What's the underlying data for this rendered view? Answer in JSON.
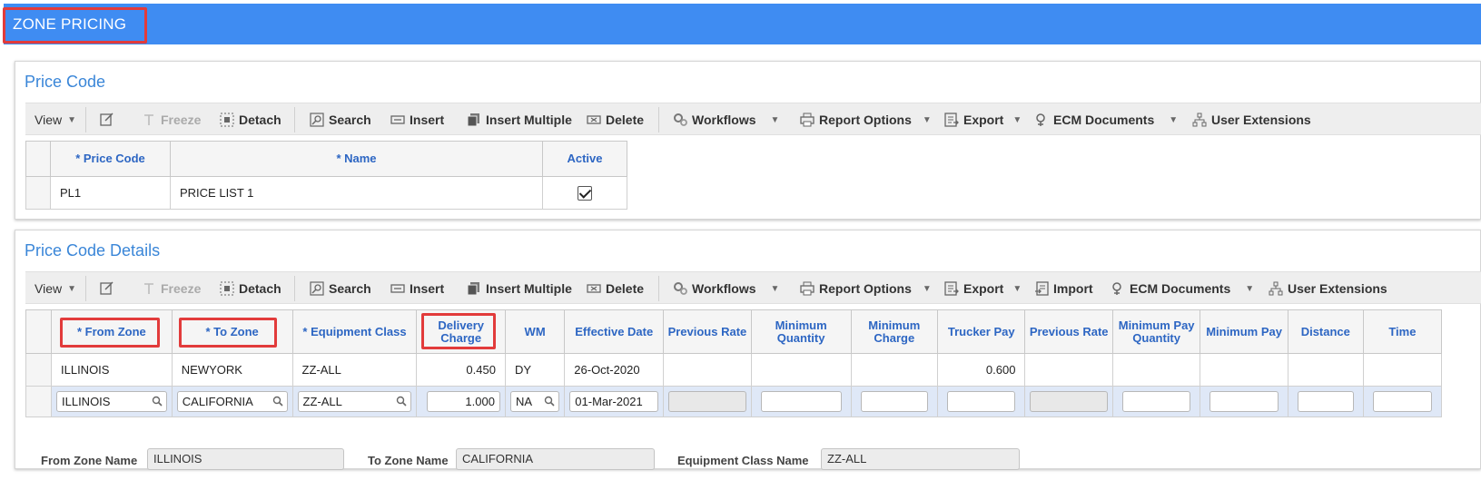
{
  "app": {
    "title": "ZONE PRICING"
  },
  "price_code_panel": {
    "title": "Price Code",
    "toolbar": {
      "view": "View",
      "freeze": "Freeze",
      "detach": "Detach",
      "search": "Search",
      "insert": "Insert",
      "insert_multiple": "Insert Multiple",
      "delete": "Delete",
      "workflows": "Workflows",
      "report_options": "Report Options",
      "export": "Export",
      "ecm_documents": "ECM Documents",
      "user_extensions": "User Extensions"
    },
    "columns": [
      "* Price Code",
      "* Name",
      "Active"
    ],
    "rows": [
      {
        "price_code": "PL1",
        "name": "PRICE LIST 1",
        "active": true
      }
    ]
  },
  "details_panel": {
    "title": "Price Code Details",
    "toolbar": {
      "view": "View",
      "freeze": "Freeze",
      "detach": "Detach",
      "search": "Search",
      "insert": "Insert",
      "insert_multiple": "Insert Multiple",
      "delete": "Delete",
      "workflows": "Workflows",
      "report_options": "Report Options",
      "export": "Export",
      "import": "Import",
      "ecm_documents": "ECM Documents",
      "user_extensions": "User Extensions"
    },
    "columns": {
      "from_zone": "* From Zone",
      "to_zone": "* To Zone",
      "equipment_class": "* Equipment Class",
      "delivery_charge": "Delivery Charge",
      "wm": "WM",
      "effective_date": "Effective Date",
      "previous_rate": "Previous Rate",
      "minimum_quantity": "Minimum Quantity",
      "minimum_charge": "Minimum Charge",
      "trucker_pay": "Trucker Pay",
      "previous_rate_2": "Previous Rate",
      "minimum_pay_quantity": "Minimum Pay Quantity",
      "minimum_pay": "Minimum Pay",
      "distance": "Distance",
      "time": "Time"
    },
    "rows": [
      {
        "from_zone": "ILLINOIS",
        "to_zone": "NEWYORK",
        "equipment_class": "ZZ-ALL",
        "delivery_charge": "0.450",
        "wm": "DY",
        "effective_date": "26-Oct-2020",
        "trucker_pay": "0.600"
      },
      {
        "from_zone": "ILLINOIS",
        "to_zone": "CALIFORNIA",
        "equipment_class": "ZZ-ALL",
        "delivery_charge": "1.000",
        "wm": "NA",
        "effective_date": "01-Mar-2021"
      }
    ],
    "form": {
      "from_zone_name_label": "From Zone Name",
      "from_zone_name_value": "ILLINOIS",
      "to_zone_name_label": "To Zone Name",
      "to_zone_name_value": "CALIFORNIA",
      "equipment_class_name_label": "Equipment Class Name",
      "equipment_class_name_value": "ZZ-ALL"
    }
  },
  "colors": {
    "title_bar": "#3f8cf2",
    "header_text": "#2d66c3",
    "panel_title": "#3a86d8",
    "highlight": "#e23b3b",
    "selected_row": "#dfe8f7"
  }
}
